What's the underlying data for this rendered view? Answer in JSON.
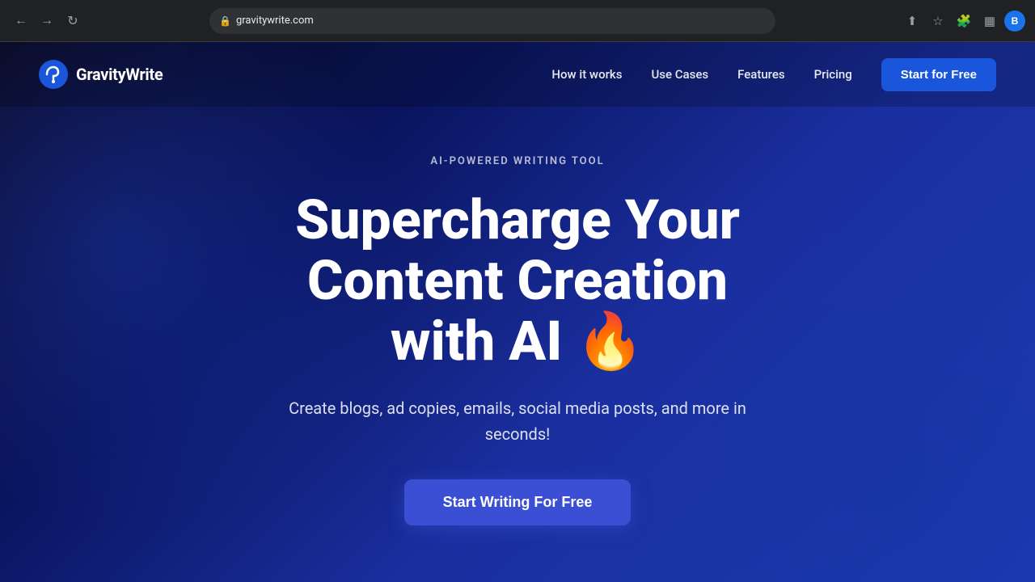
{
  "browser": {
    "url": "gravitywrite.com",
    "nav": {
      "back_label": "←",
      "forward_label": "→",
      "refresh_label": "↻"
    },
    "actions": {
      "share": "⬆",
      "bookmark": "☆",
      "extensions": "🧩",
      "sidebar": "▦",
      "profile": "B"
    }
  },
  "navbar": {
    "logo_text": "GravityWrite",
    "links": [
      {
        "label": "How it works",
        "id": "how-it-works"
      },
      {
        "label": "Use Cases",
        "id": "use-cases"
      },
      {
        "label": "Features",
        "id": "features"
      },
      {
        "label": "Pricing",
        "id": "pricing"
      }
    ],
    "cta_label": "Start for Free"
  },
  "hero": {
    "badge": "AI-POWERED WRITING TOOL",
    "title_line1": "Supercharge Your",
    "title_line2": "Content Creation",
    "title_line3": "with AI 🔥",
    "subtitle": "Create blogs, ad copies, emails, social media posts, and more in seconds!",
    "cta_label": "Start Writing For Free"
  }
}
